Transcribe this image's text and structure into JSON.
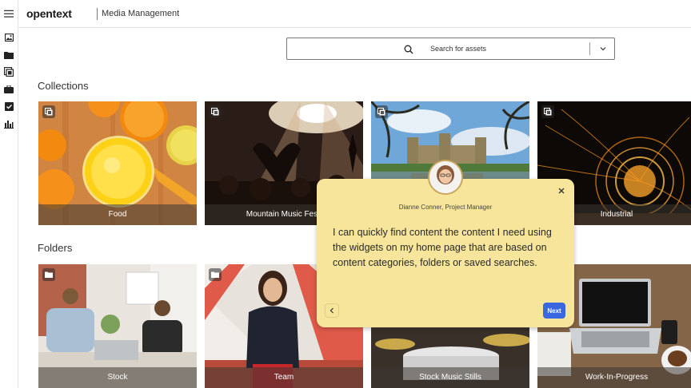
{
  "header": {
    "brand": "opentext",
    "app_name": "Media Management"
  },
  "sidebar": {
    "icons": [
      "menu-icon",
      "image-icon",
      "folder-icon",
      "collection-icon",
      "briefcase-icon",
      "task-check-icon",
      "bar-chart-icon"
    ]
  },
  "search": {
    "placeholder": "Search for assets"
  },
  "collections": {
    "title": "Collections",
    "items": [
      {
        "label": "Food"
      },
      {
        "label": "Mountain Music Festi"
      },
      {
        "label": ""
      },
      {
        "label": "Industrial"
      }
    ]
  },
  "folders": {
    "title": "Folders",
    "items": [
      {
        "label": "Stock"
      },
      {
        "label": "Team"
      },
      {
        "label": "Stock Music Stills"
      },
      {
        "label": "Work-In-Progress"
      }
    ]
  },
  "popup": {
    "author": "Dianne Conner, Project Manager",
    "message": "I can quickly find content the content I need using the widgets on my home page that are based on content categories, folders or saved searches.",
    "next_label": "Next"
  },
  "colors": {
    "popup_bg": "#f6e59a",
    "next_button": "#3a66e0"
  }
}
